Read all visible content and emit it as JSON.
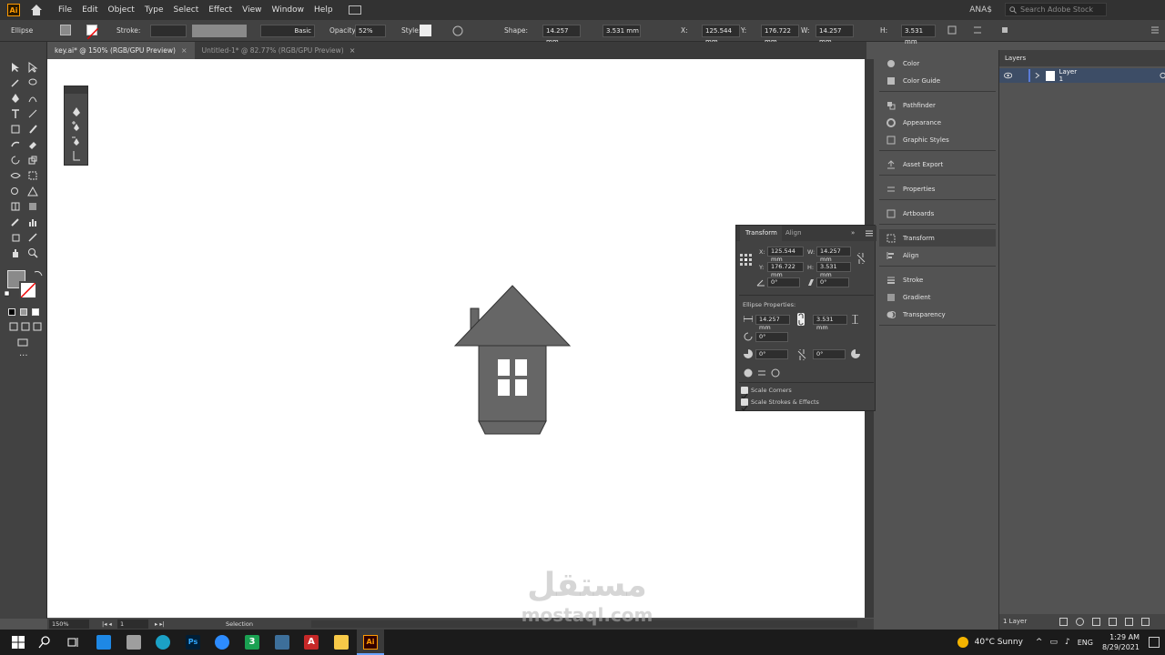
{
  "app": {
    "logo_text": "Ai"
  },
  "menu": [
    "File",
    "Edit",
    "Object",
    "Type",
    "Select",
    "Effect",
    "View",
    "Window",
    "Help"
  ],
  "topright": {
    "user": "ANA$",
    "stock_placeholder": "Search Adobe Stock"
  },
  "control_bar": {
    "object_type": "Ellipse",
    "stroke_label": "Stroke:",
    "brush_label": "Basic",
    "opacity_label": "Opacity:",
    "opacity_value": "52%",
    "style_label": "Style:",
    "shape_label": "Shape:",
    "shape_w": "14.257 mm",
    "shape_h": "3.531 mm",
    "x_label": "X:",
    "x_value": "125.544 mm",
    "y_label": "Y:",
    "y_value": "176.722 mm",
    "w_label": "W:",
    "w_value": "14.257 mm",
    "h_label": "H:",
    "h_value": "3.531 mm"
  },
  "tabs": [
    {
      "label": "key.ai* @ 150% (RGB/GPU Preview)",
      "close": "×"
    },
    {
      "label": "Untitled-1* @ 82.77% (RGB/GPU Preview)",
      "close": "×"
    }
  ],
  "dock": [
    {
      "label": "Color"
    },
    {
      "label": "Color Guide"
    },
    {
      "label": "Pathfinder"
    },
    {
      "label": "Appearance"
    },
    {
      "label": "Graphic Styles"
    },
    {
      "label": "Asset Export"
    },
    {
      "label": "Properties"
    },
    {
      "label": "Artboards"
    },
    {
      "label": "Transform"
    },
    {
      "label": "Align"
    },
    {
      "label": "Stroke"
    },
    {
      "label": "Gradient"
    },
    {
      "label": "Transparency"
    }
  ],
  "layers": {
    "tab": "Layers",
    "layer_name": "Layer 1",
    "footer": "1 Layer"
  },
  "transform_panel": {
    "tab_transform": "Transform",
    "tab_align": "Align",
    "x_label": "X:",
    "x": "125.544 mm",
    "w_label": "W:",
    "w": "14.257 mm",
    "y_label": "Y:",
    "y": "176.722 mm",
    "h_label": "H:",
    "h": "3.531 mm",
    "angle": "0°",
    "shear": "0°",
    "ellipse_props": "Ellipse Properties:",
    "ep_w": "14.257 mm",
    "ep_h": "3.531 mm",
    "rotate": "0°",
    "pie_start": "0°",
    "pie_end": "0°",
    "scale_corners": "Scale Corners",
    "scale_strokes": "Scale Strokes & Effects"
  },
  "status": {
    "zoom": "150%",
    "artboard": "1",
    "tool": "Selection"
  },
  "taskbar": {
    "weather": "40°C  Sunny",
    "lang": "ENG",
    "time": "1:29 AM",
    "date": "8/29/2021"
  },
  "watermark": {
    "arabic": "مستقل",
    "latin": "mostaql.com"
  },
  "colors": {
    "house_fill": "#666666",
    "accent_ai": "#ff9a00",
    "selection_blue": "#3d4d66"
  }
}
